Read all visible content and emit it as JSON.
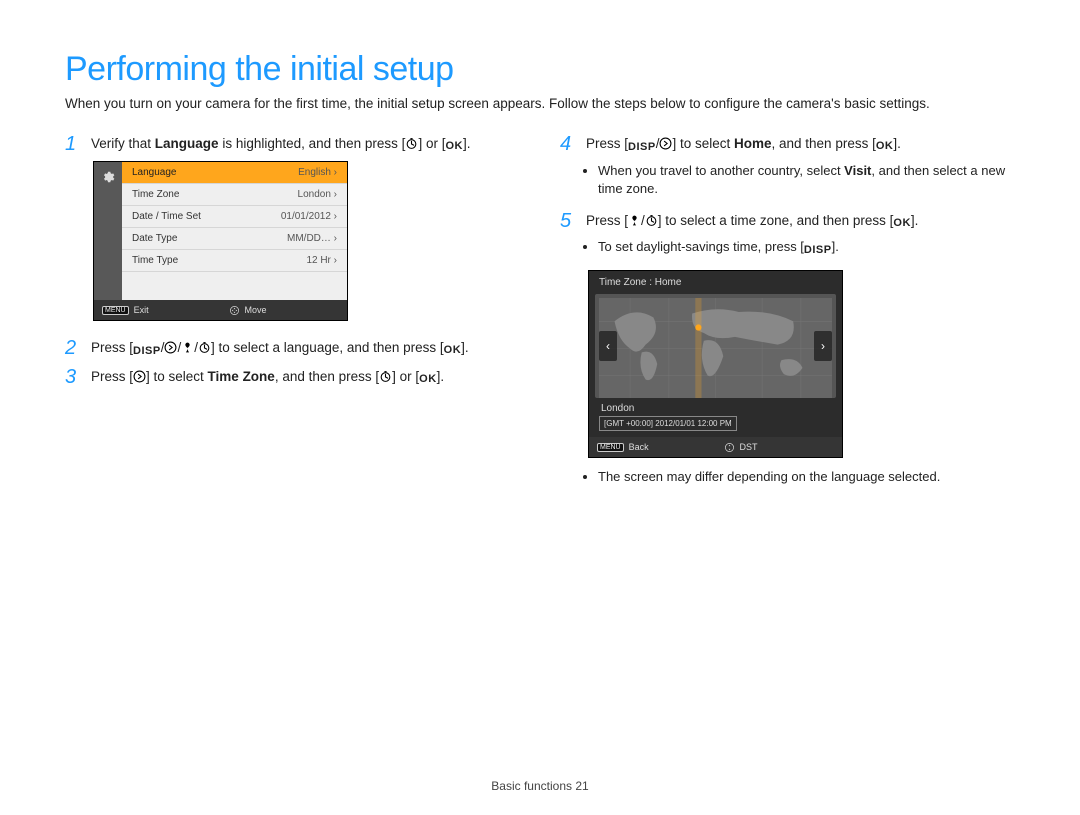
{
  "title": "Performing the initial setup",
  "intro": "When you turn on your camera for the first time, the initial setup screen appears. Follow the steps below to configure the camera's basic settings.",
  "steps": {
    "s1_a": "Verify that ",
    "s1_bold": "Language",
    "s1_b": " is highlighted, and then press [",
    "s1_c": "] or [",
    "s1_d": "].",
    "s2_a": "Press [",
    "s2_b": "] to select a language, and then press [",
    "s2_c": "].",
    "s3_a": "Press [",
    "s3_b": "] to select ",
    "s3_bold": "Time Zone",
    "s3_c": ", and then press [",
    "s3_d": "] or [",
    "s3_e": "].",
    "s4_a": "Press [",
    "s4_b": "] to select ",
    "s4_bold": "Home",
    "s4_c": ", and then press [",
    "s4_d": "].",
    "s4_bullet_a": "When you travel to another country, select ",
    "s4_bullet_bold": "Visit",
    "s4_bullet_b": ", and then select a new time zone.",
    "s5_a": "Press [",
    "s5_b": "] to select a time zone, and then press [",
    "s5_c": "].",
    "s5_bullet1_a": "To set daylight-savings time, press [",
    "s5_bullet1_b": "].",
    "s5_bullet2": "The screen may differ depending on the language selected."
  },
  "labels": {
    "disp": "DISP",
    "ok": "OK",
    "menu": "MENU"
  },
  "settings_panel": {
    "rows": [
      {
        "name": "Language",
        "value": "English ›"
      },
      {
        "name": "Time Zone",
        "value": "London ›"
      },
      {
        "name": "Date / Time Set",
        "value": "01/01/2012 ›"
      },
      {
        "name": "Date Type",
        "value": "MM/DD… ›"
      },
      {
        "name": "Time Type",
        "value": "12 Hr ›"
      }
    ],
    "footer_left": "Exit",
    "footer_right": "Move"
  },
  "tz_panel": {
    "header": "Time Zone : Home",
    "city": "London",
    "gmt": "[GMT +00:00]  2012/01/01  12:00 PM",
    "footer_left": "Back",
    "footer_right": "DST"
  },
  "footer": {
    "section": "Basic functions ",
    "page": "21"
  }
}
